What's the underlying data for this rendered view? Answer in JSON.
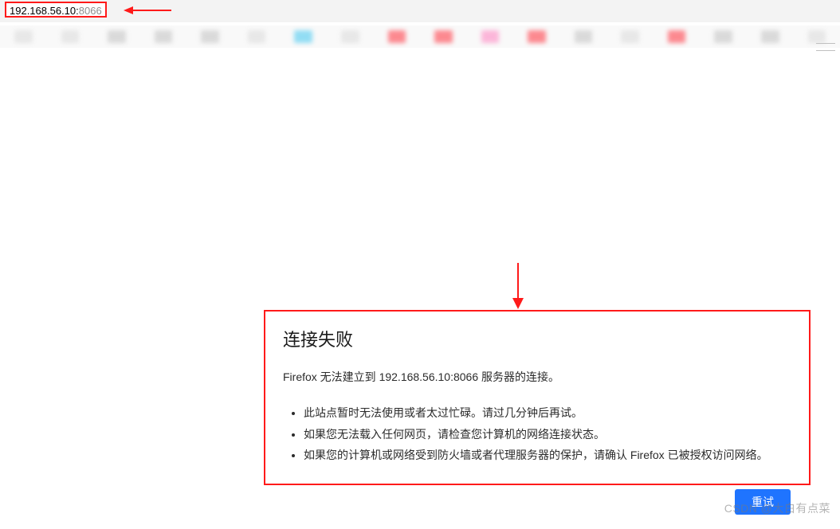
{
  "address_bar": {
    "host": "192.168.56.10",
    "port_sep": ":",
    "port": "8066"
  },
  "annotation": {
    "arrow_left_color": "#ff1a1a",
    "arrow_down_color": "#ff1a1a",
    "box_color": "#ff1a1a"
  },
  "bookmarks": {
    "count": 18
  },
  "error": {
    "title": "连接失败",
    "message": "Firefox 无法建立到 192.168.56.10:8066 服务器的连接。",
    "list": [
      "此站点暂时无法使用或者太过忙碌。请过几分钟后再试。",
      "如果您无法载入任何网页，请检查您计算机的网络连接状态。",
      "如果您的计算机或网络受到防火墙或者代理服务器的保护，请确认 Firefox 已被授权访问网络。"
    ],
    "retry_label": "重试"
  },
  "watermark": "CSDN @大白有点菜"
}
